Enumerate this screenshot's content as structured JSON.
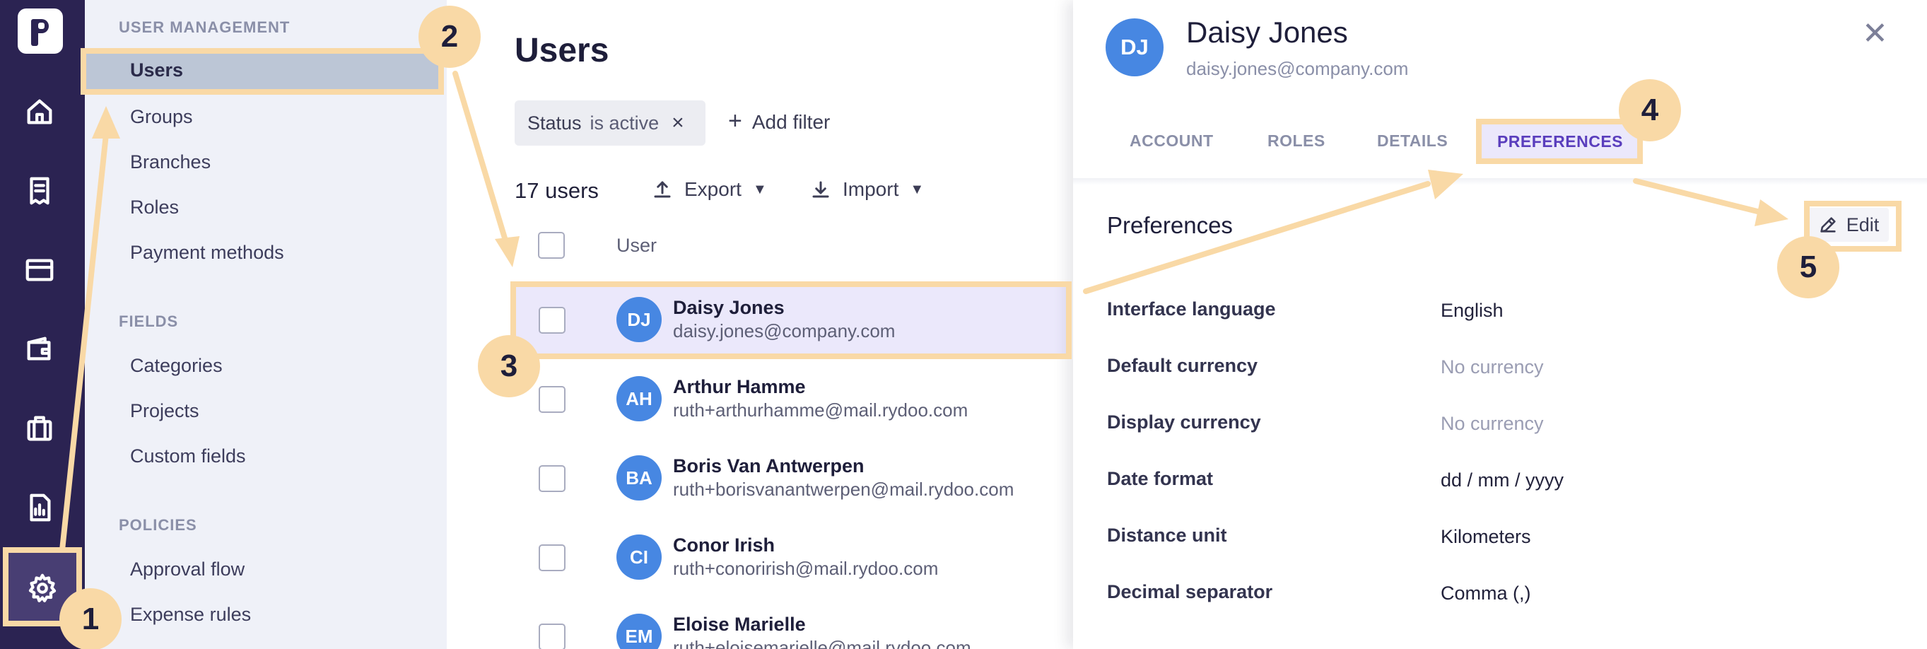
{
  "sidebar": {
    "sections": [
      {
        "title": "USER MANAGEMENT",
        "items": [
          "Users",
          "Groups",
          "Branches",
          "Roles",
          "Payment methods"
        ]
      },
      {
        "title": "FIELDS",
        "items": [
          "Categories",
          "Projects",
          "Custom fields"
        ]
      },
      {
        "title": "POLICIES",
        "items": [
          "Approval flow",
          "Expense rules"
        ]
      }
    ],
    "active_item": "Users"
  },
  "main": {
    "title": "Users",
    "filter": {
      "field": "Status",
      "value": "is active"
    },
    "add_filter_label": "Add filter",
    "count_label": "17 users",
    "export_label": "Export",
    "import_label": "Import",
    "column_header": "User",
    "users": [
      {
        "initials": "DJ",
        "name": "Daisy Jones",
        "email": "daisy.jones@company.com"
      },
      {
        "initials": "AH",
        "name": "Arthur Hamme",
        "email": "ruth+arthurhamme@mail.rydoo.com"
      },
      {
        "initials": "BA",
        "name": "Boris Van Antwerpen",
        "email": "ruth+borisvanantwerpen@mail.rydoo.com"
      },
      {
        "initials": "CI",
        "name": "Conor Irish",
        "email": "ruth+conorirish@mail.rydoo.com"
      },
      {
        "initials": "EM",
        "name": "Eloise Marielle",
        "email": "ruth+eloisemarielle@mail.rydoo.com"
      }
    ]
  },
  "panel": {
    "initials": "DJ",
    "name": "Daisy Jones",
    "email": "daisy.jones@company.com",
    "tabs": [
      "ACCOUNT",
      "ROLES",
      "DETAILS",
      "PREFERENCES"
    ],
    "active_tab": "PREFERENCES",
    "section_title": "Preferences",
    "edit_label": "Edit",
    "preferences": [
      {
        "label": "Interface language",
        "value": "English",
        "muted": false
      },
      {
        "label": "Default currency",
        "value": "No currency",
        "muted": true
      },
      {
        "label": "Display currency",
        "value": "No currency",
        "muted": true
      },
      {
        "label": "Date format",
        "value": "dd / mm / yyyy",
        "muted": false
      },
      {
        "label": "Distance unit",
        "value": "Kilometers",
        "muted": false
      },
      {
        "label": "Decimal separator",
        "value": "Comma (,)",
        "muted": false
      }
    ]
  },
  "annotations": {
    "steps": [
      "1",
      "2",
      "3",
      "4",
      "5"
    ],
    "color": "#f9d9a6"
  },
  "colors": {
    "rail": "#2b2352",
    "sidebar_bg": "#eff1f8",
    "active_item_bg": "#bcc6d6",
    "avatar": "#4787e2",
    "active_tab_text": "#5a3ebd",
    "highlight_row": "#ebe8fb"
  }
}
